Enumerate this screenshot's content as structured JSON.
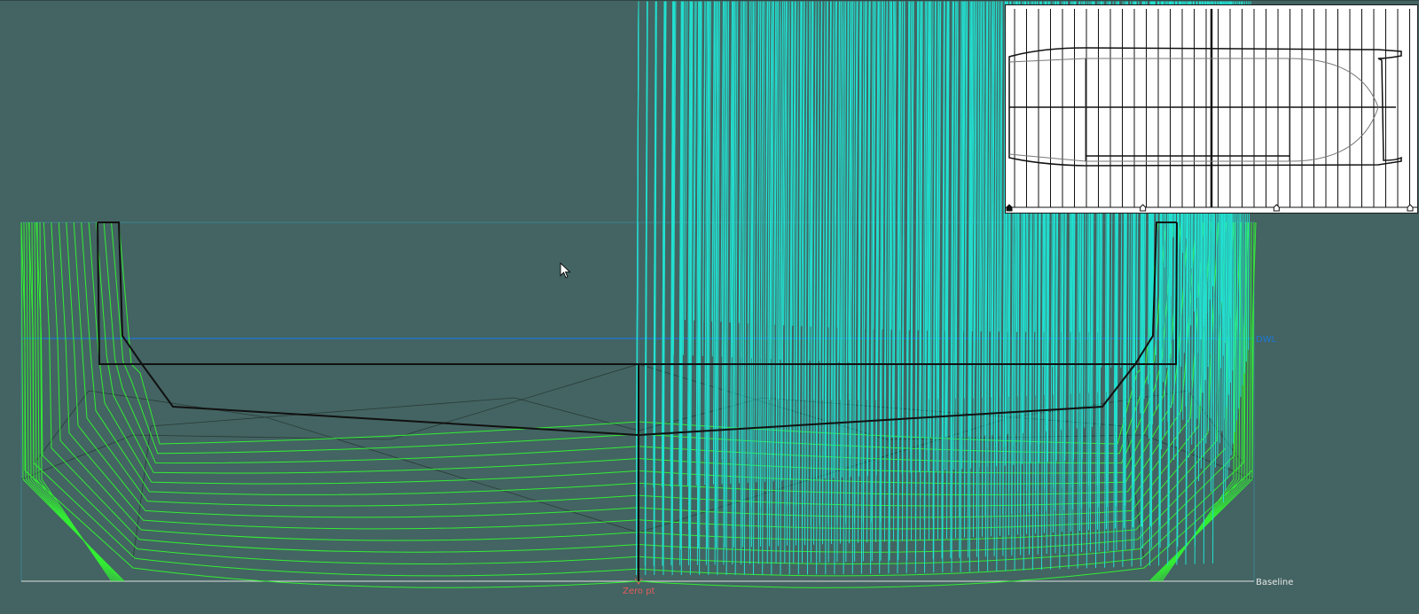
{
  "labels": {
    "dwl": "DWL",
    "baseline": "Baseline",
    "zero_point": "Zero pt"
  },
  "colors": {
    "background": "#436462",
    "station_lines": "#33ee33",
    "control_points": "#22e0d0",
    "hull_outline": "#111111",
    "dwl_line": "#1e78d8",
    "baseline": "#dddddd",
    "zero_point_label": "#e85a5a",
    "inset_background": "#ffffff"
  },
  "icons": {
    "cursor": "mouse-pointer-icon"
  },
  "plan_view": {
    "marker_count": 4
  }
}
